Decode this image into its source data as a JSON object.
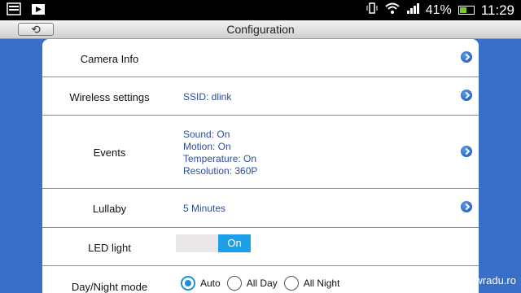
{
  "status": {
    "battery": "41%",
    "time": "11:29"
  },
  "header": {
    "back_symbol": "⟲",
    "title": "Configuration"
  },
  "rows": {
    "camera_info": {
      "label": "Camera Info"
    },
    "wireless": {
      "label": "Wireless settings",
      "value": "SSID: dlink"
    },
    "events": {
      "label": "Events",
      "lines": [
        "Sound: On",
        "Motion: On",
        "Temperature: On",
        "Resolution: 360P"
      ]
    },
    "lullaby": {
      "label": "Lullaby",
      "value": "5 Minutes"
    },
    "led": {
      "label": "LED light",
      "toggle": "On"
    },
    "daynight": {
      "label": "Day/Night mode",
      "options": [
        "Auto",
        "All Day",
        "All Night"
      ],
      "selected": "Auto"
    }
  },
  "watermark": "nwradu.ro",
  "colors": {
    "background": "#3a6fc8",
    "value_text": "#2a4f9a",
    "toggle_on": "#1ea0e6"
  }
}
